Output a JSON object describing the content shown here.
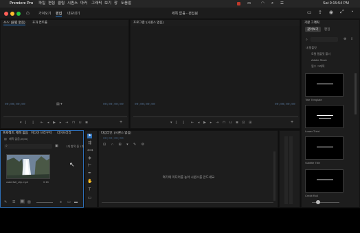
{
  "menubar": {
    "app_name": "Premiere Pro",
    "menus": [
      "파일",
      "편집",
      "클립",
      "시퀀스",
      "마커",
      "그래픽",
      "보기",
      "창",
      "도움말"
    ],
    "status_text": "Sat 9:15:54 PM"
  },
  "appbar": {
    "nav_home": "홈",
    "tabs": [
      "가져오기",
      "편집",
      "내보내기"
    ],
    "active_tab": "편집",
    "project_title": "제목 없음 - 편집됨"
  },
  "source_monitor": {
    "tabs": [
      "소스: (클립 없음)",
      "효과 컨트롤"
    ],
    "tc_left": "00;00;00;00",
    "tc_right": "00;00;00;00"
  },
  "program_monitor": {
    "title": "프로그램: (시퀀스 없음)",
    "tc_left": "00;00;00;00",
    "tc_right": "00;00;00;00"
  },
  "project_panel": {
    "tabs": [
      "프로젝트: 제목 없음",
      "미디어 브라우저",
      "라이브러리"
    ],
    "project_file": "제목 없음.prproj",
    "search_placeholder": "",
    "item_count": "1개 항목 중 1개",
    "clip_name": "waterfall_clip.mp4",
    "clip_duration": "0:15"
  },
  "timeline_panel": {
    "tab": "타임라인: (시퀀스 없음)",
    "timecode": "00;00;00;00",
    "empty_message": "여기에 미디어를 놓아 시퀀스를 만드세요."
  },
  "effects_panel": {
    "title": "기본 그래픽",
    "tabs": [
      "찾아보기",
      "편집"
    ],
    "search_placeholder": "",
    "tree": [
      "내 템플릿",
      "로컬 템플릿 폴더",
      "Adobe Stock",
      "필수 그래픽"
    ],
    "templates": [
      "Title Template",
      "Lower Third",
      "Subtitle Title",
      "Credit Roll"
    ]
  },
  "tools": [
    "select-icon",
    "track-select-icon",
    "ripple-edit-icon",
    "razor-icon",
    "slip-icon",
    "pen-icon",
    "hand-icon",
    "type-icon"
  ]
}
